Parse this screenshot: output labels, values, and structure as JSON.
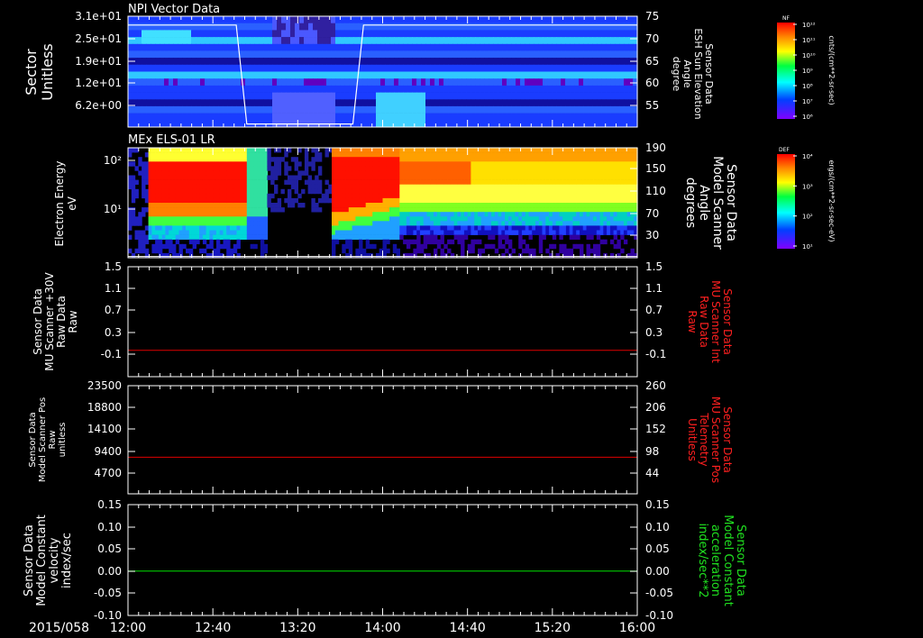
{
  "chart_data": [
    {
      "type": "heatmap",
      "title": "NPI Vector Data",
      "ylabel": [
        "Sector",
        "Unitless"
      ],
      "y_ticks": [
        "3.1e+01",
        "2.5e+01",
        "1.9e+01",
        "1.2e+01",
        "6.2e+00"
      ],
      "y2label": [
        "Sensor Data",
        "ESH Sun Elevation",
        "Angle",
        "degree"
      ],
      "y2_ticks": [
        "75",
        "70",
        "65",
        "60",
        "55"
      ],
      "y2lim": [
        50,
        75
      ],
      "overlay_line": {
        "x": [
          "12:00",
          "12:51",
          "12:56",
          "13:46",
          "13:51",
          "16:00"
        ],
        "y": [
          73,
          73,
          50.7,
          50.7,
          73,
          73
        ]
      },
      "colorbar": {
        "label": "NF",
        "units": "cnts/(cm**2-sr-sec)",
        "ticks": [
          "10¹²",
          "10¹¹",
          "10¹⁰",
          "10⁹",
          "10⁸",
          "10⁷",
          "10⁶"
        ]
      }
    },
    {
      "type": "heatmap",
      "title": "MEx ELS-01 LR",
      "ylabel": [
        "Electron Energy",
        "eV"
      ],
      "y_ticks": [
        "10²",
        "10¹"
      ],
      "y2label": [
        "Sensor Data",
        "Model Scanner",
        "Angle",
        "degrees"
      ],
      "y2_ticks": [
        "190",
        "150",
        "110",
        "70",
        "30"
      ],
      "y2lim": [
        10,
        190
      ],
      "overlay_line": {
        "x": [
          "12:00",
          "16:00"
        ],
        "y": [
          12,
          12
        ]
      },
      "colorbar": {
        "label": "DEF",
        "units": "ergs/(cm**2-sr-sec-eV)",
        "ticks": [
          "10⁴",
          "10³",
          "10²",
          "10¹"
        ]
      }
    },
    {
      "type": "line",
      "ylabel": [
        "Sensor Data",
        "MU Scanner +30V",
        "Raw Data",
        "Raw"
      ],
      "y_ticks": [
        "1.5",
        "1.1",
        "0.7",
        "0.3",
        "-0.1"
      ],
      "ylim": [
        -0.5,
        1.5
      ],
      "y2label": [
        "Sensor Data",
        "MU Scanner Int",
        "Raw Data",
        "Raw"
      ],
      "y2_ticks": [
        "1.5",
        "1.1",
        "0.7",
        "0.3",
        "-0.1"
      ],
      "series": [
        {
          "x": [
            "12:00",
            "16:00"
          ],
          "y": [
            -0.02,
            -0.02
          ],
          "color": "#e00000"
        }
      ]
    },
    {
      "type": "line",
      "ylabel": [
        "Sensor Data",
        "Model Scanner Pos",
        "Raw",
        "unitless"
      ],
      "y_ticks": [
        "23500",
        "18800",
        "14100",
        "9400",
        "4700"
      ],
      "ylim": [
        0,
        23500
      ],
      "y2label": [
        "Sensor Data",
        "MU Scanner Pos",
        "Telemetry",
        "Unitless"
      ],
      "y2_ticks": [
        "260",
        "206",
        "152",
        "98",
        "44"
      ],
      "series": [
        {
          "x": [
            "12:00",
            "16:00"
          ],
          "y": [
            7950,
            7950
          ],
          "color": "#e00000"
        }
      ]
    },
    {
      "type": "line",
      "ylabel": [
        "Sensor Data",
        "Model Constant",
        "velocity",
        "index/sec"
      ],
      "y_ticks": [
        "0.15",
        "0.10",
        "0.05",
        "0.00",
        "-0.05",
        "-0.10"
      ],
      "ylim": [
        -0.1,
        0.15
      ],
      "y2label": [
        "Sensor Data",
        "Model Constant",
        "acceleration",
        "index/sec**2"
      ],
      "y2_ticks": [
        "0.15",
        "0.10",
        "0.05",
        "0.00",
        "-0.05",
        "-0.10"
      ],
      "series": [
        {
          "x": [
            "12:00",
            "16:00"
          ],
          "y": [
            0,
            0
          ],
          "color": "#00e000"
        }
      ]
    }
  ],
  "x_axis": {
    "date_label": "2015/058",
    "ticks": [
      "12:00",
      "12:40",
      "13:20",
      "14:00",
      "14:40",
      "15:20",
      "16:00"
    ]
  },
  "colors": {
    "background": "#000000",
    "red_series": "#e00000",
    "green_series": "#00e000",
    "red_label": "#ff2020",
    "green_label": "#20e020"
  }
}
